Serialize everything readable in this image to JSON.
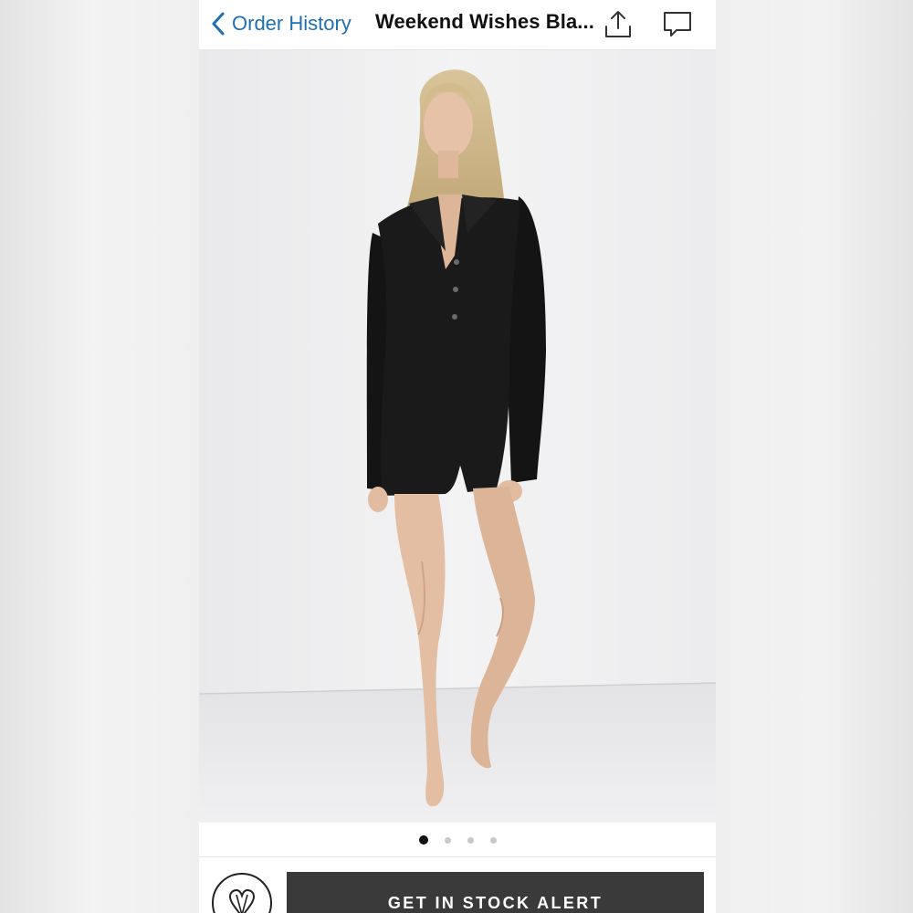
{
  "nav": {
    "back_label": "Order History",
    "title": "Weekend Wishes Bla...",
    "share_icon": "share-icon",
    "comment_icon": "comment-icon"
  },
  "gallery": {
    "image_count": 4,
    "active_index": 0
  },
  "footer": {
    "brand_icon": "brand-heart-logo",
    "cta_label": "GET IN STOCK ALERT"
  },
  "colors": {
    "link": "#1f6fb2",
    "cta_background": "#3a3a3a",
    "active_dot": "#111111"
  }
}
